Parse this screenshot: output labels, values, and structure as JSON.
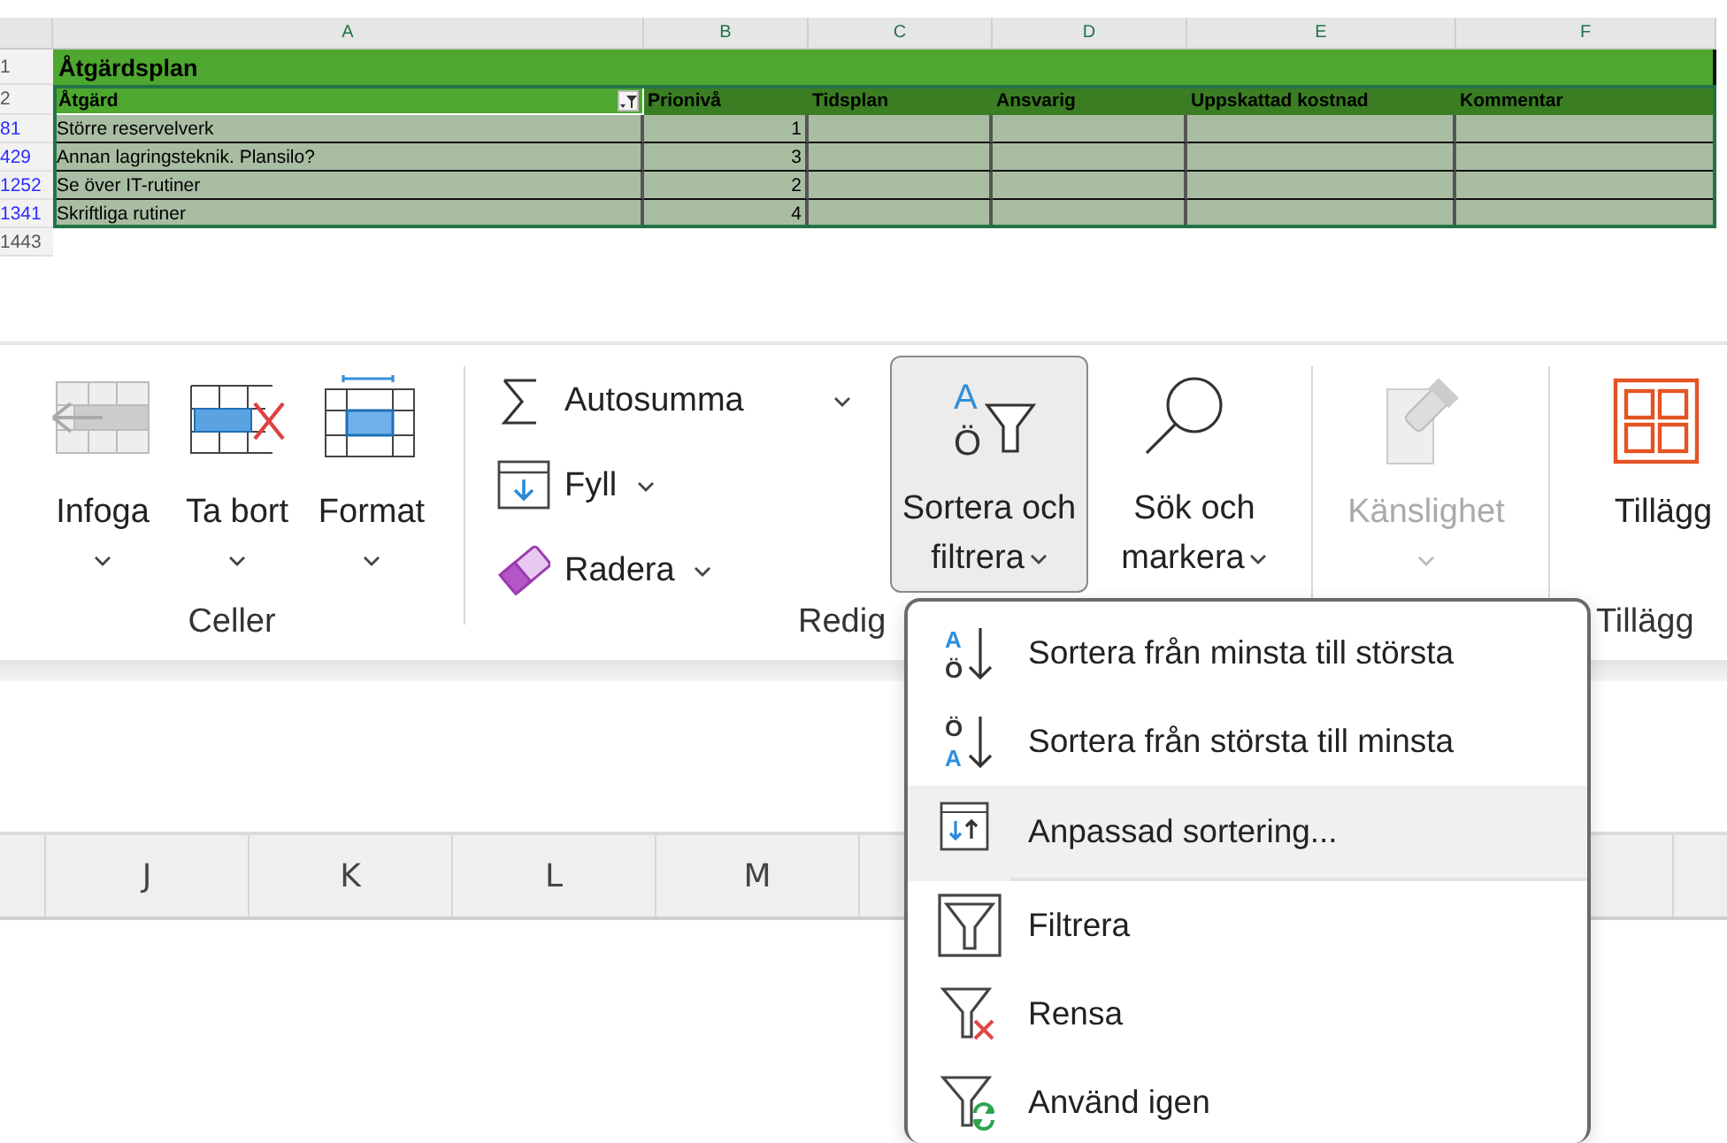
{
  "spreadsheet": {
    "column_headers": [
      "A",
      "B",
      "C",
      "D",
      "E",
      "F"
    ],
    "title_row": {
      "number": "1",
      "title": "Åtgärdsplan"
    },
    "header_row": {
      "number": "2",
      "headers": [
        "Åtgärd",
        "Prionivå",
        "Tidsplan",
        "Ansvarig",
        "Uppskattad kostnad",
        "Kommentar"
      ]
    },
    "rows": [
      {
        "number": "81",
        "action": "Större reservelverk",
        "priority": "1"
      },
      {
        "number": "429",
        "action": "Annan lagringsteknik. Plansilo?",
        "priority": "3"
      },
      {
        "number": "1252",
        "action": "Se över IT-rutiner",
        "priority": "2"
      },
      {
        "number": "1341",
        "action": "Skriftliga rutiner",
        "priority": "4"
      }
    ],
    "next_row_number": "1443"
  },
  "ribbon": {
    "groups": [
      {
        "label": "Celler",
        "buttons": [
          {
            "kind": "large",
            "label": "Infoga",
            "dropdown": true,
            "disabled": false,
            "expanded": false
          },
          {
            "kind": "large",
            "label": "Ta bort",
            "dropdown": true,
            "disabled": false,
            "expanded": false
          },
          {
            "kind": "large",
            "label": "Format",
            "dropdown": true,
            "disabled": false,
            "expanded": false
          }
        ]
      },
      {
        "label": "Redig",
        "buttons": [
          {
            "kind": "split",
            "label": "Autosumma",
            "dropdown": true,
            "disabled": false,
            "expanded": false
          },
          {
            "kind": "small",
            "label": "Fyll",
            "dropdown": true,
            "disabled": false,
            "expanded": false
          },
          {
            "kind": "small",
            "label": "Radera",
            "dropdown": true,
            "disabled": false,
            "expanded": false
          },
          {
            "kind": "large",
            "label": "Sortera och\nfiltrera",
            "icon_letters": [
              "A",
              "Ö"
            ],
            "dropdown": true,
            "disabled": false,
            "expanded": true
          },
          {
            "kind": "large",
            "label": "Sök och\nmarkera",
            "dropdown": true,
            "disabled": false,
            "expanded": false
          }
        ]
      },
      {
        "buttons": [
          {
            "kind": "large",
            "label": "Känslighet",
            "dropdown": true,
            "disabled": true,
            "expanded": false
          }
        ]
      },
      {
        "label": "Tillägg",
        "buttons": [
          {
            "kind": "large",
            "label": "Tillägg",
            "dropdown": false,
            "disabled": false,
            "expanded": false
          }
        ]
      }
    ]
  },
  "lower_grid": {
    "column_headers": [
      "J",
      "K",
      "L",
      "M"
    ]
  },
  "sort_menu": {
    "items": [
      {
        "label": "Sortera från minsta till största",
        "icon_letters": [
          "A",
          "Ö"
        ],
        "selected": false,
        "separator_after": false
      },
      {
        "label": "Sortera från största till minsta",
        "icon_letters": [
          "Ö",
          "A"
        ],
        "selected": false,
        "separator_after": false
      },
      {
        "label": "Anpassad sortering...",
        "selected": true,
        "separator_after": true
      },
      {
        "label": "Filtrera",
        "selected": false,
        "separator_after": false
      },
      {
        "label": "Rensa",
        "selected": false,
        "separator_after": false
      },
      {
        "label": "Använd igen",
        "selected": false,
        "separator_after": false
      }
    ]
  }
}
